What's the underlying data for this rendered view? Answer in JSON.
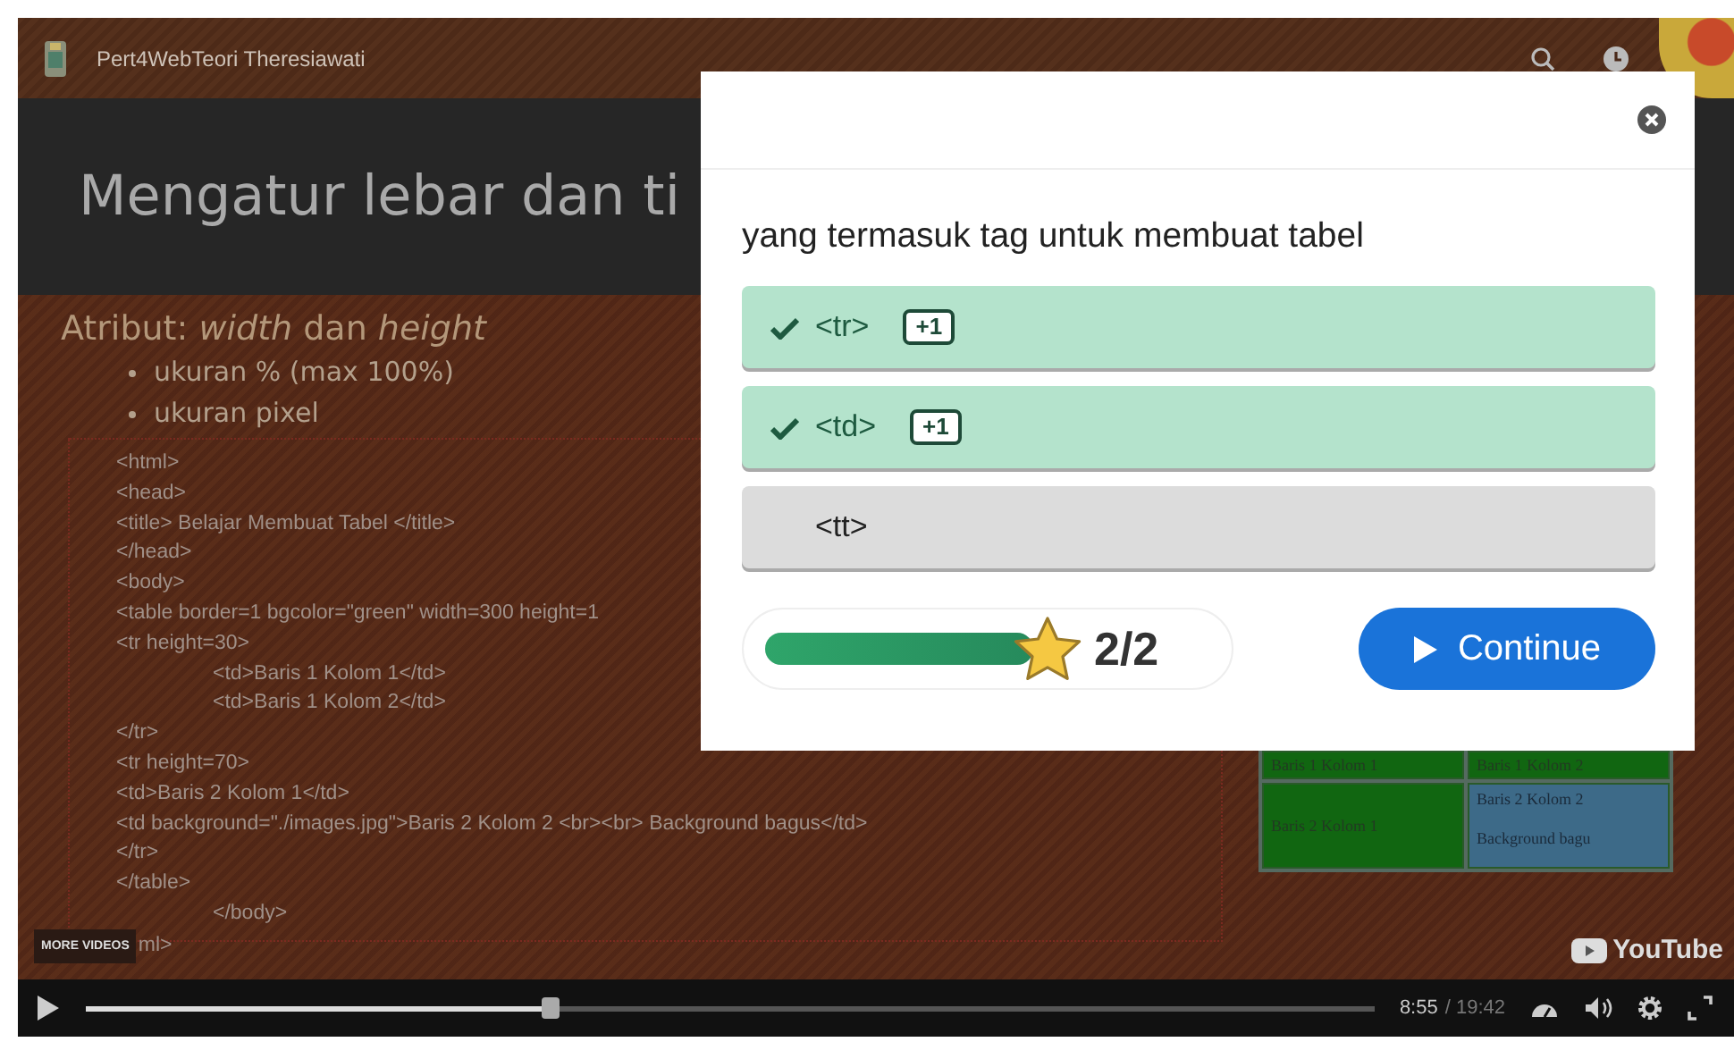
{
  "video": {
    "channel_title": "Pert4WebTeori Theresiawati",
    "more_videos": "MORE VIDEOS",
    "brand": "YouTube",
    "time_current": "8:55",
    "time_total": "/ 19:42",
    "level": 0.36
  },
  "slide": {
    "title": "Mengatur lebar dan ti",
    "subtitle": "Atribut: *width* dan *height*",
    "bullets": [
      "ukuran % (max 100%)",
      "ukuran pixel"
    ],
    "code_lines": [
      {
        "text": "<html>",
        "kind": "plain"
      },
      {
        "text": "<head>",
        "kind": "plain"
      },
      {
        "text": "<title> Belajar Membuat Tabel </title>",
        "kind": "plain"
      },
      {
        "text": "</head>",
        "kind": "plain"
      },
      {
        "text": "<body>",
        "kind": "plain"
      },
      {
        "text": "<table border=1 bgcolor=\"green\" width=300 height=1",
        "kind": "plain"
      },
      {
        "text": "<tr height=30>",
        "kind": "plain"
      },
      {
        "text": "<td>Baris 1 Kolom 1</td>",
        "kind": "indented"
      },
      {
        "text": "<td>Baris 1 Kolom 2</td>",
        "kind": "indented"
      },
      {
        "text": "</tr>",
        "kind": "plain"
      },
      {
        "text": "<tr height=70>",
        "kind": "plain"
      },
      {
        "text": "<td>Baris 2 Kolom 1</td>",
        "kind": "plain"
      },
      {
        "text": "<td background=\"./images.jpg\">Baris 2 Kolom 2 <br><br> Background bagus</td>",
        "kind": "plain"
      },
      {
        "text": "</tr>",
        "kind": "plain"
      },
      {
        "text": "</table>",
        "kind": "plain"
      },
      {
        "text": "</body>",
        "kind": "indented"
      },
      {
        "text": "ml>",
        "kind": "covered"
      }
    ],
    "rendered_table": {
      "rows": [
        {
          "cells": [
            {
              "text": "Baris 1 Kolom 1",
              "kind": "green"
            },
            {
              "text": "Baris 1 Kolom 2",
              "kind": "green"
            }
          ]
        },
        {
          "cells": [
            {
              "text": "Baris 2 Kolom 1",
              "kind": "green"
            },
            {
              "text": "Baris 2 Kolom 2",
              "kind": "image",
              "extra": "Background bagu"
            }
          ]
        }
      ]
    }
  },
  "quiz": {
    "question": "yang termasuk tag untuk membuat tabel",
    "options": [
      {
        "label": "<tr>",
        "correct": true,
        "badge": "+1"
      },
      {
        "label": "<td>",
        "correct": true,
        "badge": "+1"
      },
      {
        "label": "<tt>",
        "correct": false
      }
    ],
    "level": 1,
    "score": "2/2",
    "continue": "Continue"
  }
}
